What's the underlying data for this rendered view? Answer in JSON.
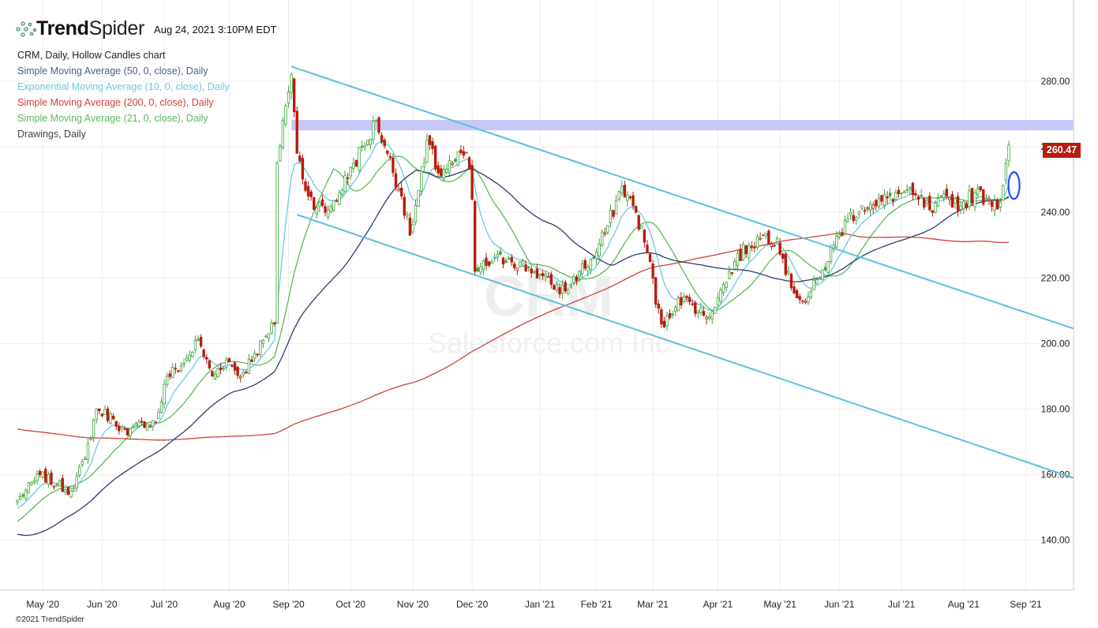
{
  "header": {
    "brand_bold": "Trend",
    "brand_light": "Spider",
    "timestamp": "Aug 24, 2021 3:10PM EDT"
  },
  "legend": {
    "chart": "CRM, Daily, Hollow Candles chart",
    "items": [
      {
        "label": "Simple Moving Average (50, 0, close), Daily",
        "color": "#2c3e6b"
      },
      {
        "label": "Exponential Moving Average (10, 0, close), Daily",
        "color": "#6cc9e0"
      },
      {
        "label": "Simple Moving Average (200, 0, close), Daily",
        "color": "#d0403a"
      },
      {
        "label": "Simple Moving Average (21, 0, close), Daily",
        "color": "#5cb85c"
      },
      {
        "label": "Drawings, Daily",
        "color": "#444444"
      }
    ]
  },
  "watermark": {
    "symbol": "CRM",
    "name": "Salesforce.com Inc"
  },
  "footer": {
    "copyright": "©2021 TrendSpider"
  },
  "chart_data": {
    "type": "candlestick",
    "symbol": "CRM",
    "interval": "Daily",
    "last_price": "260.47",
    "last_price_value": 260.47,
    "ylim": [
      128,
      290
    ],
    "y_ticks": [
      "280.00",
      "260.00",
      "240.00",
      "220.00",
      "200.00",
      "180.00",
      "160.00",
      "140.00"
    ],
    "y_tick_values": [
      280,
      260,
      240,
      220,
      200,
      180,
      160,
      140
    ],
    "x_ticks": [
      {
        "label": "May '20",
        "date": "2020-05-01"
      },
      {
        "label": "Jun '20",
        "date": "2020-06-01"
      },
      {
        "label": "Jul '20",
        "date": "2020-07-01"
      },
      {
        "label": "Aug '20",
        "date": "2020-08-03"
      },
      {
        "label": "Sep '20",
        "date": "2020-09-01"
      },
      {
        "label": "Oct '20",
        "date": "2020-10-01"
      },
      {
        "label": "Nov '20",
        "date": "2020-11-02"
      },
      {
        "label": "Dec '20",
        "date": "2020-12-01"
      },
      {
        "label": "Jan '21",
        "date": "2021-01-04"
      },
      {
        "label": "Feb '21",
        "date": "2021-02-01"
      },
      {
        "label": "Mar '21",
        "date": "2021-03-01"
      },
      {
        "label": "Apr '21",
        "date": "2021-04-01"
      },
      {
        "label": "May '21",
        "date": "2021-05-03"
      },
      {
        "label": "Jun '21",
        "date": "2021-06-01"
      },
      {
        "label": "Jul '21",
        "date": "2021-07-01"
      },
      {
        "label": "Aug '21",
        "date": "2021-08-02"
      },
      {
        "label": "Sep '21",
        "date": "2021-09-01"
      }
    ],
    "x_range": [
      "2020-04-20",
      "2021-09-14"
    ],
    "close_waypoints": [
      [
        "2020-04-20",
        152
      ],
      [
        "2020-04-30",
        160
      ],
      [
        "2020-05-08",
        157
      ],
      [
        "2020-05-15",
        155
      ],
      [
        "2020-05-22",
        165
      ],
      [
        "2020-05-28",
        180
      ],
      [
        "2020-06-05",
        177
      ],
      [
        "2020-06-12",
        172
      ],
      [
        "2020-06-19",
        176
      ],
      [
        "2020-06-26",
        176
      ],
      [
        "2020-07-02",
        190
      ],
      [
        "2020-07-10",
        194
      ],
      [
        "2020-07-17",
        201
      ],
      [
        "2020-07-24",
        190
      ],
      [
        "2020-07-31",
        195
      ],
      [
        "2020-08-07",
        190
      ],
      [
        "2020-08-14",
        197
      ],
      [
        "2020-08-21",
        203
      ],
      [
        "2020-08-25",
        206
      ],
      [
        "2020-08-26",
        255
      ],
      [
        "2020-08-28",
        268
      ],
      [
        "2020-09-02",
        282
      ],
      [
        "2020-09-04",
        258
      ],
      [
        "2020-09-10",
        245
      ],
      [
        "2020-09-18",
        240
      ],
      [
        "2020-09-25",
        246
      ],
      [
        "2020-10-02",
        255
      ],
      [
        "2020-10-09",
        262
      ],
      [
        "2020-10-14",
        268
      ],
      [
        "2020-10-20",
        258
      ],
      [
        "2020-10-27",
        245
      ],
      [
        "2020-10-30",
        233
      ],
      [
        "2020-11-06",
        255
      ],
      [
        "2020-11-09",
        262
      ],
      [
        "2020-11-13",
        252
      ],
      [
        "2020-11-20",
        255
      ],
      [
        "2020-11-27",
        258
      ],
      [
        "2020-12-01",
        244
      ],
      [
        "2020-12-02",
        222
      ],
      [
        "2020-12-10",
        225
      ],
      [
        "2020-12-18",
        226
      ],
      [
        "2020-12-31",
        222
      ],
      [
        "2021-01-08",
        218
      ],
      [
        "2021-01-15",
        216
      ],
      [
        "2021-01-22",
        222
      ],
      [
        "2021-01-29",
        226
      ],
      [
        "2021-02-05",
        236
      ],
      [
        "2021-02-12",
        248
      ],
      [
        "2021-02-19",
        240
      ],
      [
        "2021-02-26",
        225
      ],
      [
        "2021-03-02",
        212
      ],
      [
        "2021-03-05",
        205
      ],
      [
        "2021-03-12",
        214
      ],
      [
        "2021-03-19",
        212
      ],
      [
        "2021-03-26",
        208
      ],
      [
        "2021-04-01",
        214
      ],
      [
        "2021-04-09",
        225
      ],
      [
        "2021-04-16",
        230
      ],
      [
        "2021-04-23",
        233
      ],
      [
        "2021-04-30",
        232
      ],
      [
        "2021-05-07",
        217
      ],
      [
        "2021-05-14",
        213
      ],
      [
        "2021-05-21",
        220
      ],
      [
        "2021-05-28",
        230
      ],
      [
        "2021-06-04",
        238
      ],
      [
        "2021-06-11",
        242
      ],
      [
        "2021-06-18",
        242
      ],
      [
        "2021-06-25",
        245
      ],
      [
        "2021-07-02",
        246
      ],
      [
        "2021-07-09",
        244
      ],
      [
        "2021-07-16",
        240
      ],
      [
        "2021-07-23",
        245
      ],
      [
        "2021-07-30",
        242
      ],
      [
        "2021-08-06",
        246
      ],
      [
        "2021-08-13",
        244
      ],
      [
        "2021-08-19",
        243
      ],
      [
        "2021-08-23",
        255
      ],
      [
        "2021-08-24",
        260.47
      ]
    ],
    "indicators": [
      {
        "name": "SMA 50",
        "period": 50,
        "kind": "sma",
        "color": "#2c3e6b"
      },
      {
        "name": "EMA 10",
        "period": 10,
        "kind": "ema",
        "color": "#6cc9e0"
      },
      {
        "name": "SMA 200",
        "period": 200,
        "kind": "sma",
        "color": "#d0403a"
      },
      {
        "name": "SMA 21",
        "period": 21,
        "kind": "sma",
        "color": "#5cb85c"
      }
    ],
    "drawings": {
      "resistance_zone": {
        "low": 265,
        "high": 268.2,
        "from": "2020-09-02",
        "color": "#c8c8f8"
      },
      "channel_upper": {
        "p1": [
          "2020-09-02",
          284.5
        ],
        "p2": [
          "2021-06-01",
          228.5
        ],
        "color": "#5bc0de"
      },
      "channel_lower": {
        "p1": [
          "2020-09-04",
          239.3
        ],
        "p2": [
          "2021-06-01",
          183.2
        ],
        "color": "#5bc0de"
      },
      "ellipse": {
        "date": "2021-08-25",
        "low": 244.1,
        "high": 252.3,
        "color": "#1a4fff"
      }
    },
    "up_color": "#3ea33e",
    "down_color": "#b71c0c"
  }
}
